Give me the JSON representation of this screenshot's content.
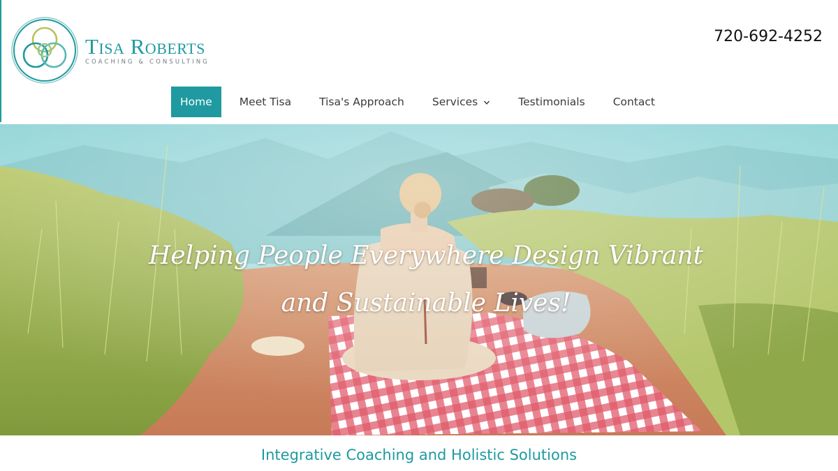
{
  "brand": {
    "name": "Tisa Roberts",
    "tagline": "Coaching & Consulting",
    "logo_icon": "interlocking-circles-logo",
    "primary_color": "#1e9aa0"
  },
  "header": {
    "phone": "720-692-4252"
  },
  "nav": {
    "items": [
      {
        "label": "Home",
        "active": true
      },
      {
        "label": "Meet Tisa"
      },
      {
        "label": "Tisa's Approach"
      },
      {
        "label": "Services",
        "has_dropdown": true,
        "icon": "chevron-down-icon"
      },
      {
        "label": "Testimonials"
      },
      {
        "label": "Contact"
      }
    ]
  },
  "hero": {
    "headline": "Helping People Everywhere Design Vibrant and Sustainable Lives!"
  },
  "section": {
    "tagline": "Integrative Coaching and Holistic Solutions"
  }
}
